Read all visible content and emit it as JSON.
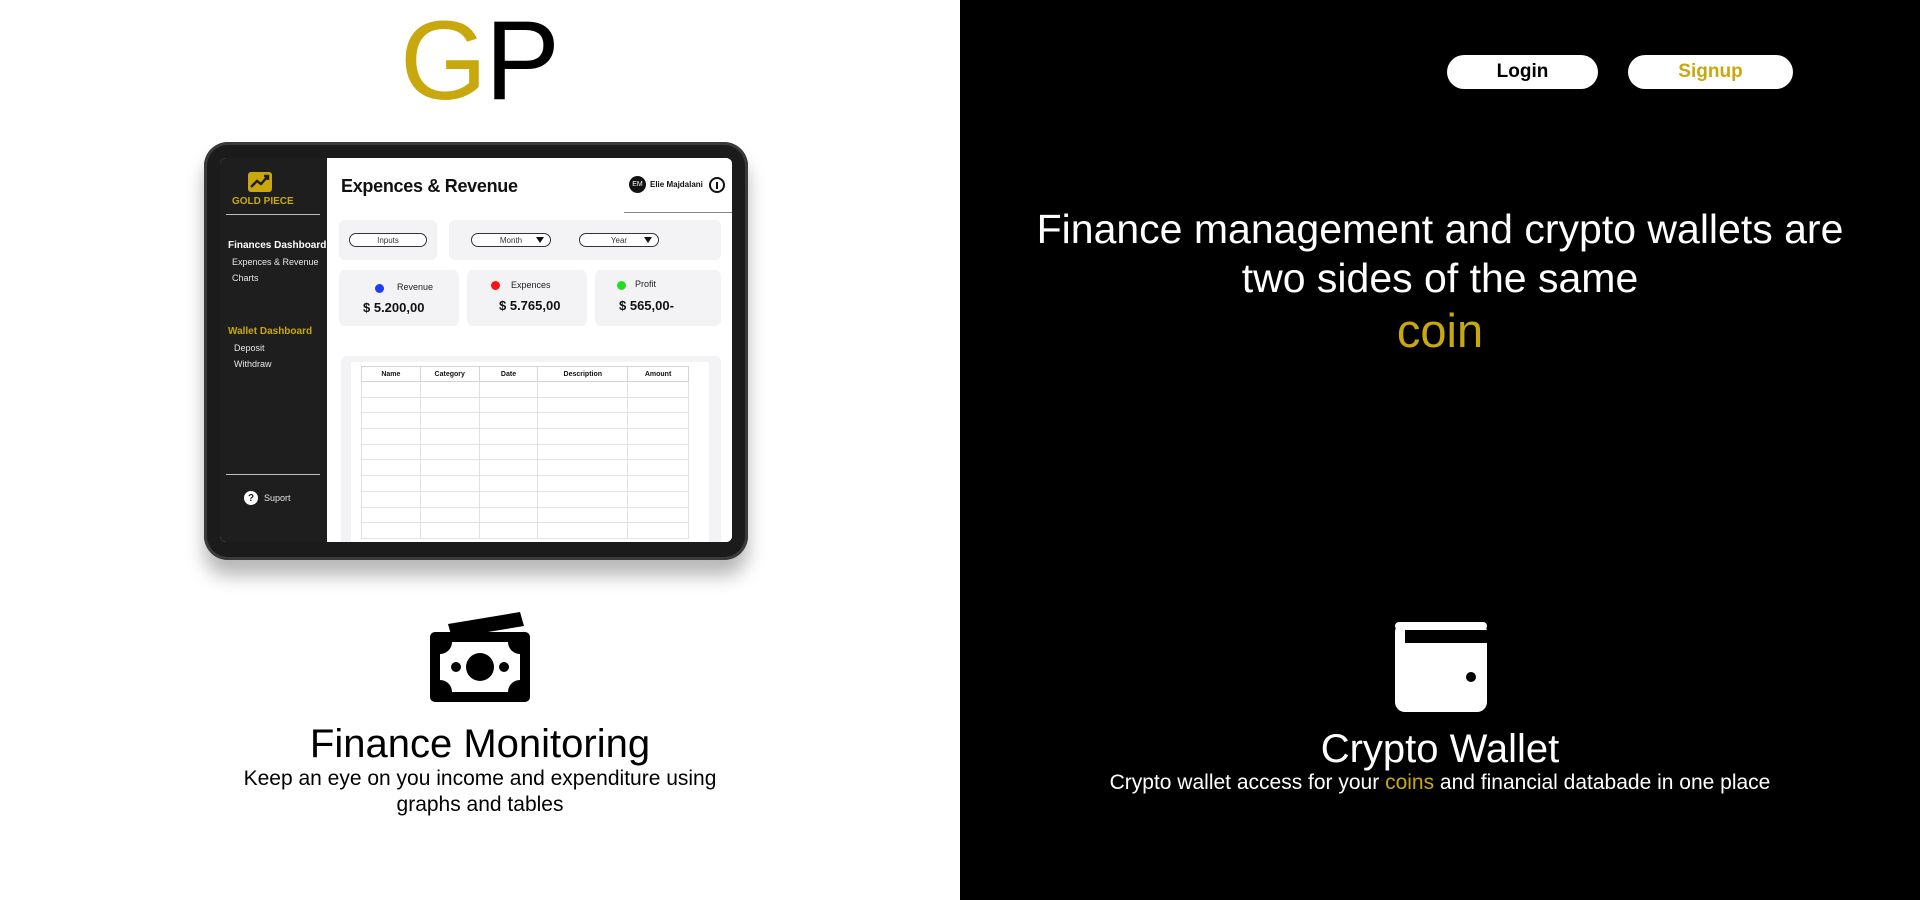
{
  "logo": {
    "letter_1": "G",
    "letter_2": "P",
    "accent_color": "#c9a80e"
  },
  "dashboard_mockup": {
    "brand_name": "GOLD PIECE",
    "sidebar": {
      "finances_heading": "Finances Dashboard",
      "finances_items": [
        "Expences & Revenue",
        "Charts"
      ],
      "wallet_heading": "Wallet Dashboard",
      "wallet_items": [
        "Deposit",
        "Withdraw"
      ],
      "support_label": "Suport"
    },
    "title": "Expences & Revenue",
    "user": {
      "initials": "EM",
      "name": "Elie Majdalani"
    },
    "filters": {
      "inputs_label": "Inputs",
      "month_label": "Month",
      "year_label": "Year"
    },
    "stats": [
      {
        "label": "Revenue",
        "value": "$ 5.200,00",
        "color": "#1f3cff"
      },
      {
        "label": "Expences",
        "value": "$ 5.765,00",
        "color": "#ff1010"
      },
      {
        "label": "Profit",
        "value": "$ 565,00-",
        "color": "#22dd22"
      }
    ],
    "table_columns": [
      "Name",
      "Category",
      "Date",
      "Description",
      "Amount"
    ]
  },
  "finance_monitoring": {
    "icon": "money-icon",
    "title": "Finance Monitoring",
    "description": "Keep an eye on you income and expenditure using graphs and tables"
  },
  "auth": {
    "login_label": "Login",
    "signup_label": "Signup"
  },
  "hero": {
    "headline": "Finance management and crypto wallets are two sides of the same",
    "accent_word": "coin"
  },
  "crypto_wallet": {
    "icon": "wallet-icon",
    "title": "Crypto Wallet",
    "description_before": "Crypto wallet access for your ",
    "description_accent": "coins",
    "description_after": " and financial databade in one place"
  }
}
